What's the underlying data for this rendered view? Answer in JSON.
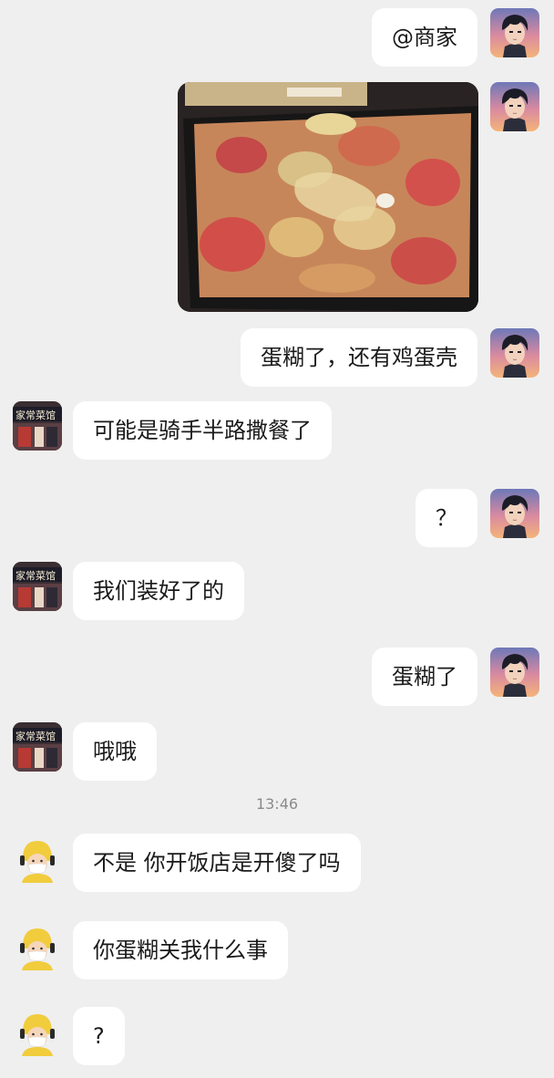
{
  "messages": [
    {
      "side": "right",
      "sender": "customer",
      "text": "@商家"
    },
    {
      "side": "right",
      "sender": "customer",
      "type": "image"
    },
    {
      "side": "right",
      "sender": "customer",
      "text": "蛋糊了，还有鸡蛋壳"
    },
    {
      "side": "left",
      "sender": "restaurant",
      "text": "可能是骑手半路撒餐了"
    },
    {
      "side": "right",
      "sender": "customer",
      "text": "？"
    },
    {
      "side": "left",
      "sender": "restaurant",
      "text": "我们装好了的"
    },
    {
      "side": "right",
      "sender": "customer",
      "text": "蛋糊了"
    },
    {
      "side": "left",
      "sender": "restaurant",
      "text": "哦哦"
    },
    {
      "side": "left",
      "sender": "rider",
      "text": "不是 你开饭店是开傻了吗"
    },
    {
      "side": "left",
      "sender": "rider",
      "text": "你蛋糊关我什么事"
    },
    {
      "side": "left",
      "sender": "rider",
      "text": "?"
    }
  ],
  "timestamp": "13:46",
  "restaurant_sign": "家常菜馆",
  "colors": {
    "background": "#efefef",
    "bubble": "#ffffff",
    "timestamp": "#8a8a8a",
    "rider_helmet": "#f1cc3d"
  }
}
